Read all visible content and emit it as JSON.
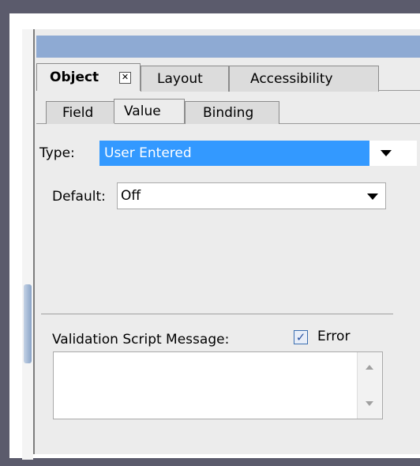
{
  "tabs": {
    "main": [
      {
        "label": "Object",
        "active": true
      },
      {
        "label": "Layout",
        "active": false
      },
      {
        "label": "Accessibility",
        "active": false
      }
    ],
    "sub": [
      {
        "label": "Field",
        "active": false
      },
      {
        "label": "Value",
        "active": true
      },
      {
        "label": "Binding",
        "active": false
      }
    ],
    "close_glyph": "✕"
  },
  "value": {
    "type_label": "Type:",
    "type_selected": "User Entered",
    "default_label": "Default:",
    "default_value": "Off",
    "validation_label": "Validation Script Message:",
    "error_label": "Error",
    "error_checked": true,
    "message_text": ""
  },
  "colors": {
    "titlebar": "#8eaad3",
    "selection": "#3399ff",
    "panel": "#ececec"
  }
}
